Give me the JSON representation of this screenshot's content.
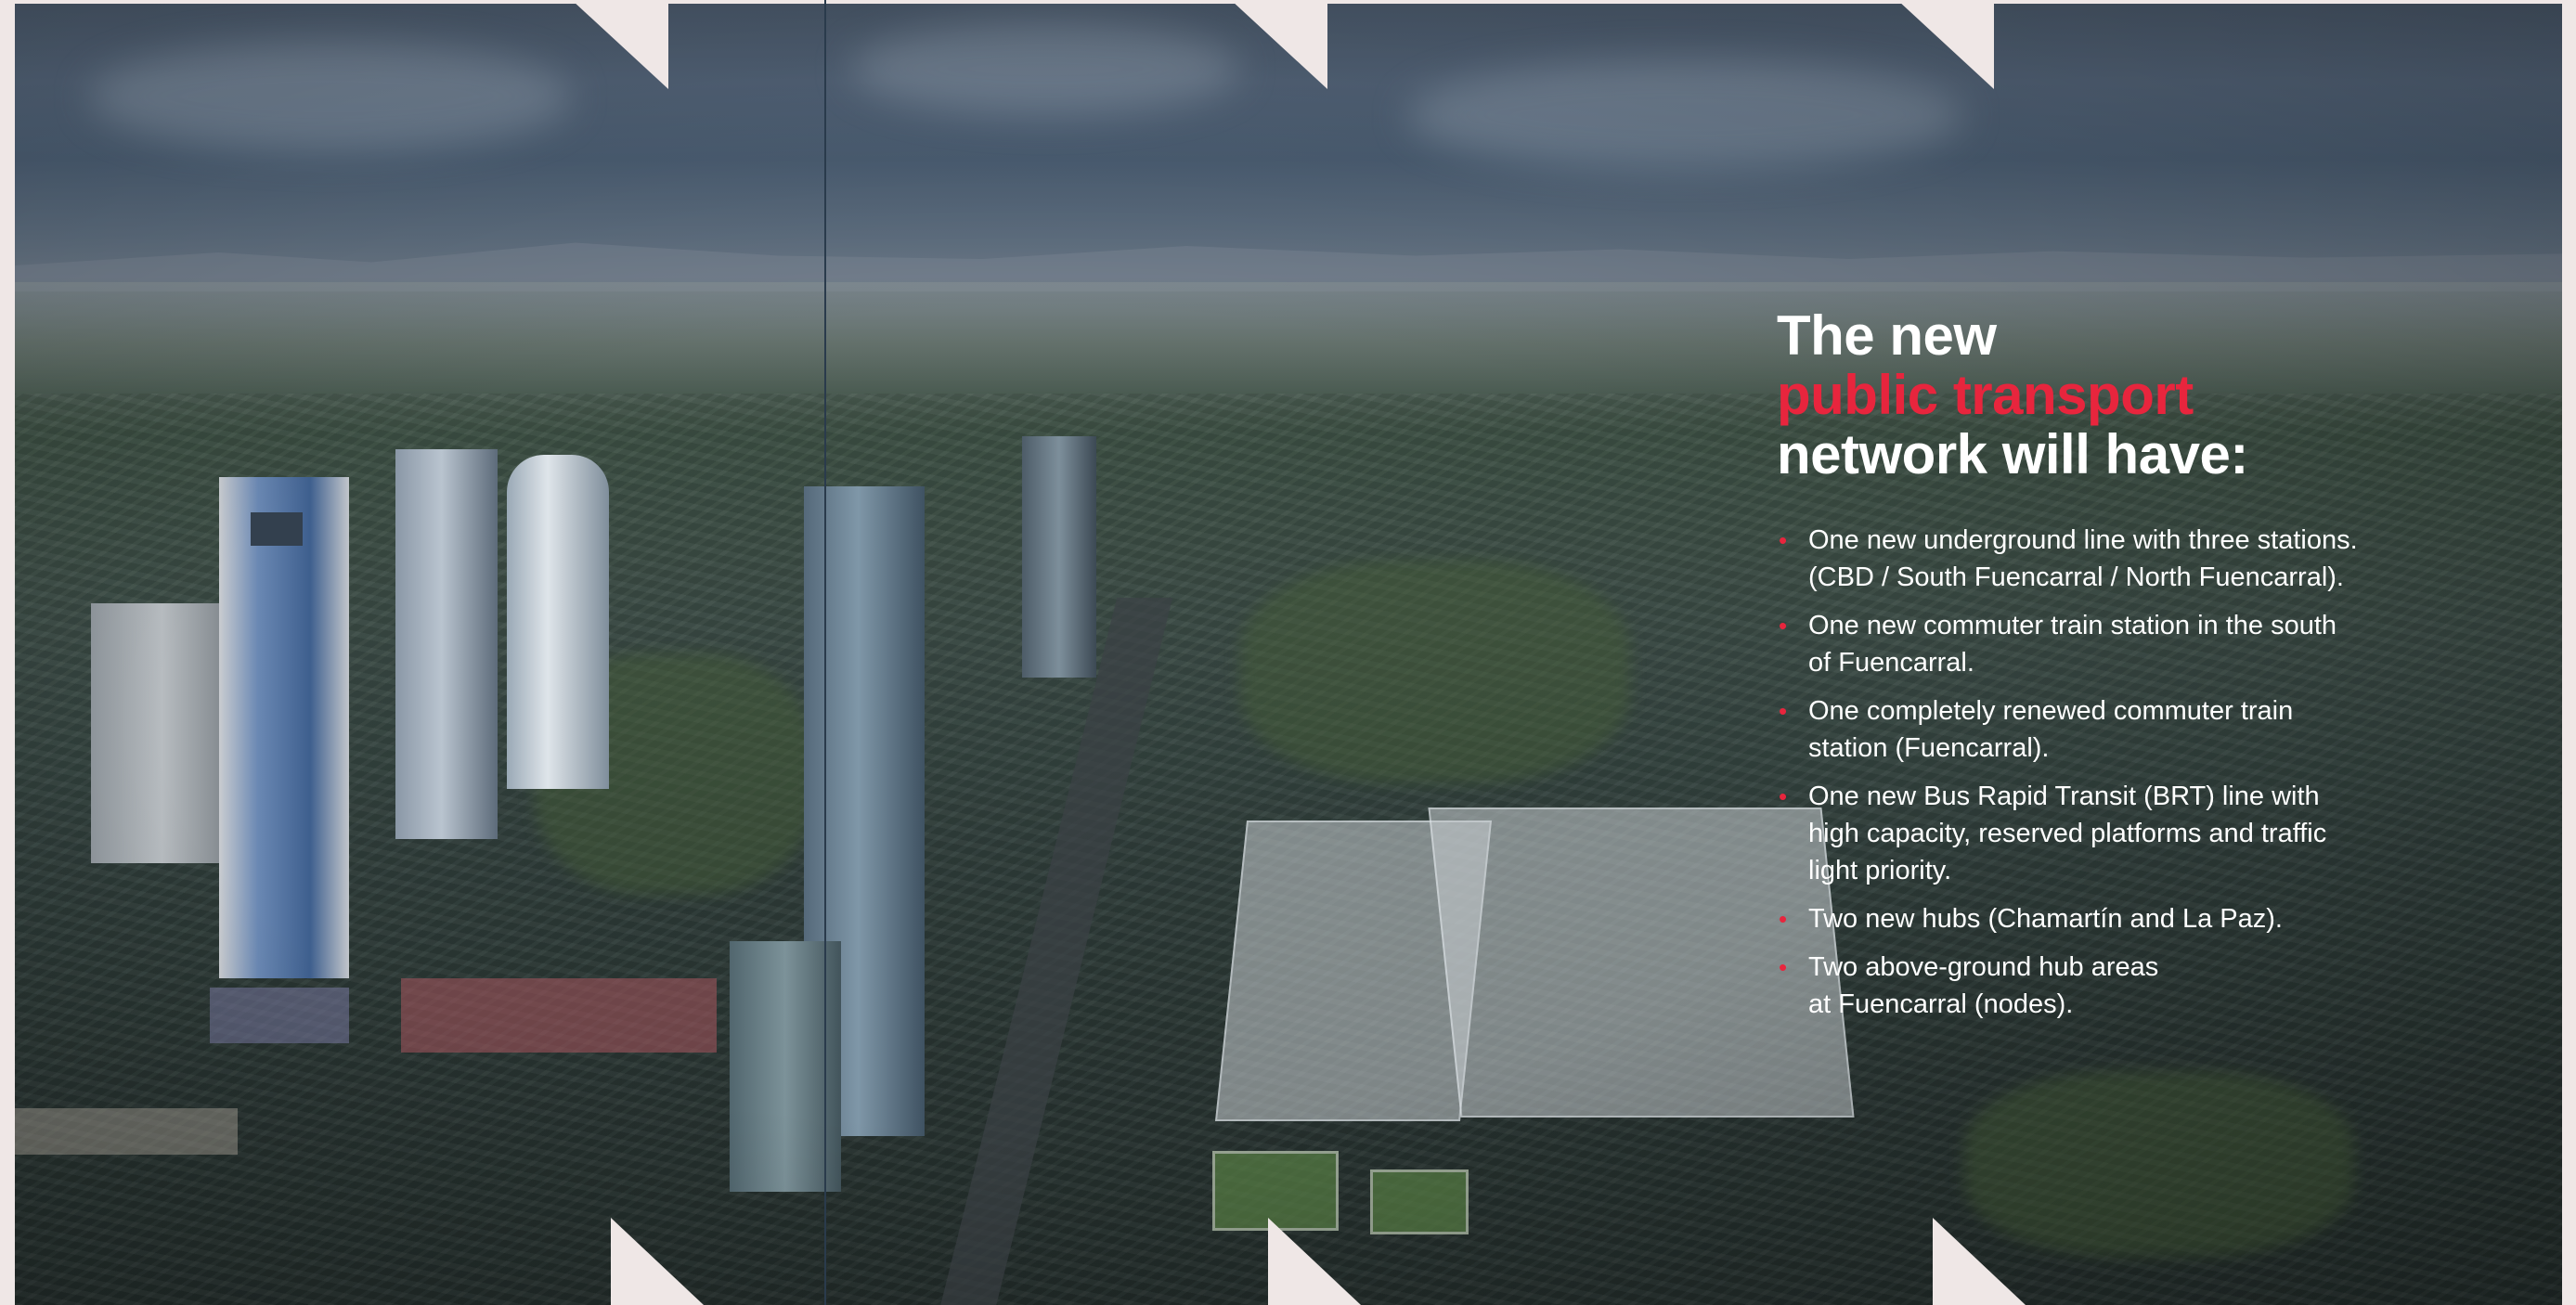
{
  "colors": {
    "accent": "#e8253d",
    "text": "#ffffff",
    "paper": "#efe7e6"
  },
  "heading": {
    "line1": "The new",
    "line2": "public transport",
    "line3": "network will have:"
  },
  "points": [
    {
      "text": "One new underground line with three stations.\n (CBD / South Fuencarral / North Fuencarral)."
    },
    {
      "text": "One new commuter train station in the south\nof Fuencarral."
    },
    {
      "text": "One completely renewed commuter train\nstation (Fuencarral)."
    },
    {
      "text": "One new Bus Rapid Transit (BRT) line with\nhigh capacity, reserved platforms and traffic\nlight priority."
    },
    {
      "text": "Two new hubs (Chamartín and La Paz)."
    },
    {
      "text": "Two above-ground hub areas\nat Fuencarral (nodes)."
    }
  ],
  "bullet_glyph": "•",
  "image": {
    "subject": "aerial-city-rendering-icon"
  }
}
